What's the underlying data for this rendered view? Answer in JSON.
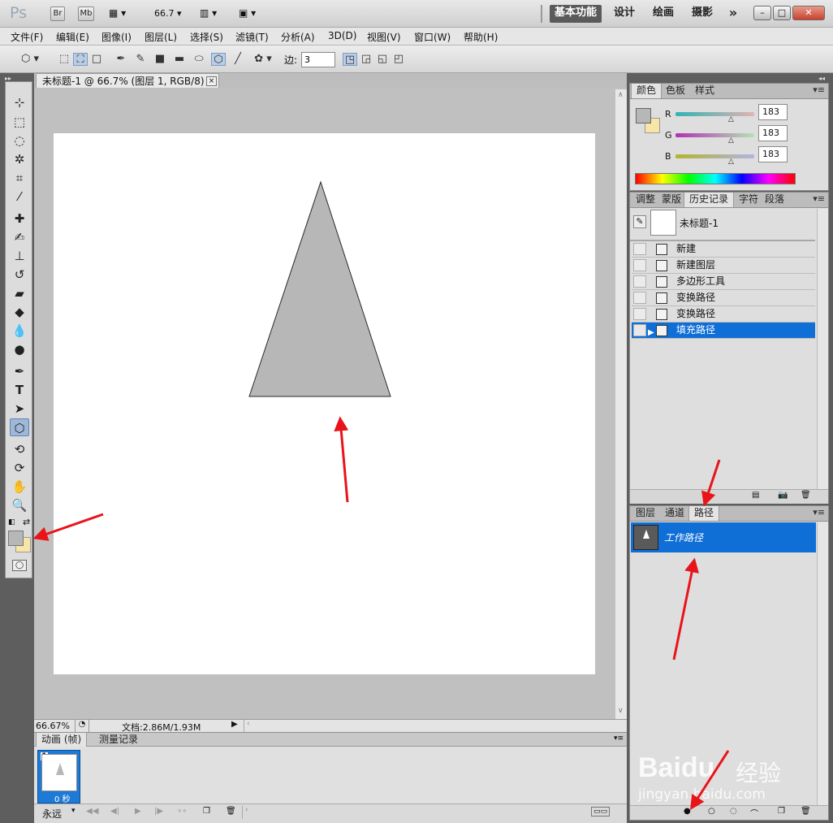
{
  "titlebar": {
    "app_logo": "Ps",
    "bridge": "Br",
    "minibridge": "Mb",
    "zoom": "66.7",
    "workspaces": [
      "基本功能",
      "设计",
      "绘画",
      "摄影"
    ],
    "more": "»"
  },
  "menu": [
    "文件(F)",
    "编辑(E)",
    "图像(I)",
    "图层(L)",
    "选择(S)",
    "滤镜(T)",
    "分析(A)",
    "3D(D)",
    "视图(V)",
    "窗口(W)",
    "帮助(H)"
  ],
  "options": {
    "sides_label": "边:",
    "sides_value": "3"
  },
  "document": {
    "tab_title": "未标题-1 @ 66.7% (图层 1, RGB/8) *",
    "close": "×",
    "zoom_percent": "66.67%",
    "doc_size": "文档:2.86M/1.93M"
  },
  "animation": {
    "tabs": [
      "动画 (帧)",
      "测量记录"
    ],
    "frame_number": "1",
    "frame_delay": "0 秒",
    "loop": "永远"
  },
  "color_panel": {
    "tabs": [
      "颜色",
      "色板",
      "样式"
    ],
    "channels": [
      {
        "label": "R",
        "value": "183"
      },
      {
        "label": "G",
        "value": "183"
      },
      {
        "label": "B",
        "value": "183"
      }
    ]
  },
  "history_panel": {
    "tabs": [
      "调整",
      "蒙版",
      "历史记录",
      "字符",
      "段落"
    ],
    "snapshot": "未标题-1",
    "items": [
      "新建",
      "新建图层",
      "多边形工具",
      "变换路径",
      "变换路径",
      "填充路径"
    ]
  },
  "paths_panel": {
    "tabs": [
      "图层",
      "通道",
      "路径"
    ],
    "path_name": "工作路径"
  },
  "watermark": {
    "brand": "Baidu",
    "suffix": "经验",
    "url": "jingyan.baidu.com"
  },
  "colors": {
    "accent": "#0f6fd6",
    "shape_fill": "#b7b7b7",
    "arrow": "#e8141a"
  }
}
